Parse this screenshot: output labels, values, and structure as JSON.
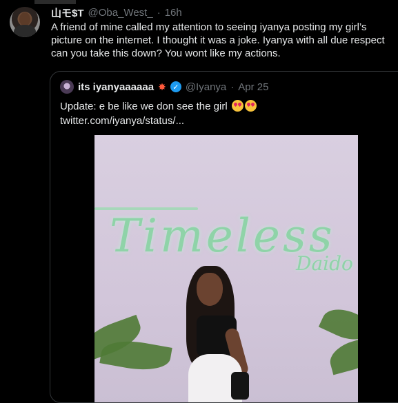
{
  "tweet": {
    "display_name": "山モ$T",
    "handle": "@Oba_West_",
    "separator": "·",
    "time": "16h",
    "lines": [
      "A friend of mine called my attention to seeing iyanya posting my girl’s",
      "picture on the internet. I thought it was a joke. Iyanya with all due respect",
      "can you take this down? You wont like my actions."
    ]
  },
  "quoted_tweet": {
    "display_name": "its iyanyaaaaaa",
    "name_emoji": "sparkle-icon",
    "verified_icon": "verified-badge-icon",
    "verified_color": "#1d9bf0",
    "handle": "@Iyanya",
    "separator": "·",
    "date": "Apr 25",
    "text": "Update: e be like we don see the girl",
    "emojis": [
      "heart-eyes-emoji",
      "heart-eyes-emoji"
    ],
    "link": "twitter.com/iyanya/status/..."
  },
  "photo": {
    "sign_text": "Timeless",
    "sign_small_text": "Daido"
  },
  "colors": {
    "background": "#000000",
    "text_primary": "#e7e9ea",
    "text_secondary": "#71767b",
    "border": "#333639"
  }
}
